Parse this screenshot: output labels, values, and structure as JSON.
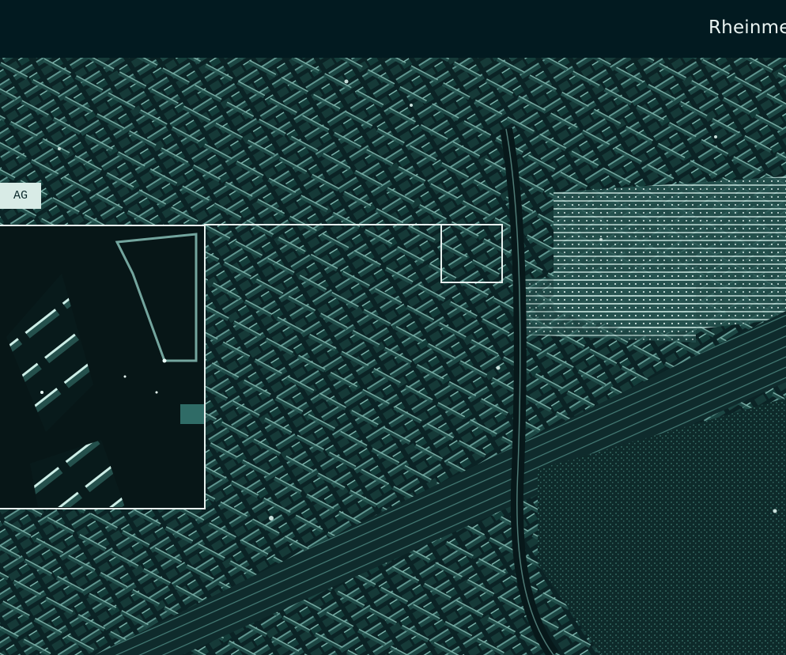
{
  "header": {
    "title": "Rheinmetall"
  },
  "image": {
    "kind": "SAR satellite image of an urban area",
    "tint": "#2f6b66",
    "highlight": "#d8f2ec"
  },
  "tag": {
    "label": "AG"
  },
  "colors": {
    "header_bg": "#021a20",
    "frame": "#e8f2ef"
  }
}
